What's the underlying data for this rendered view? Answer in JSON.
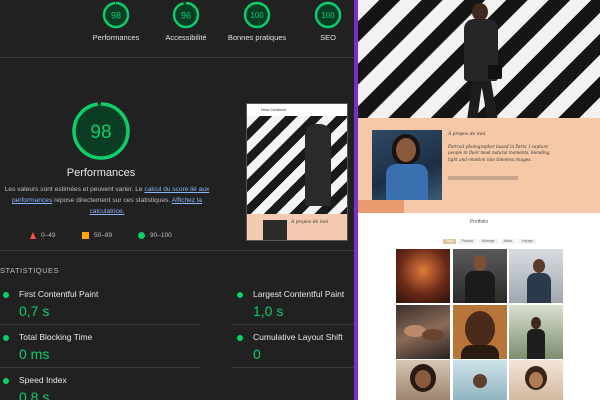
{
  "report": {
    "top_scores": [
      {
        "score": "98",
        "label": "Performances"
      },
      {
        "score": "96",
        "label": "Accessibilité"
      },
      {
        "score": "100",
        "label": "Bonnes pratiques"
      },
      {
        "score": "100",
        "label": "SEO"
      }
    ],
    "main_score": "98",
    "main_title": "Performances",
    "desc_part1": "Les valeurs sont estimées et peuvent varier. Le ",
    "desc_link1": "calcul du score lié aux performances",
    "desc_part2": " repose directement sur ces statistiques. ",
    "desc_link2": "Affichez la calculatrice.",
    "legend": [
      "0–49",
      "50–89",
      "90–100"
    ],
    "stats_title": "STATISTIQUES",
    "metrics": [
      {
        "name": "First Contentful Paint",
        "value": "0,7 s"
      },
      {
        "name": "Largest Contentful Paint",
        "value": "1,0 s"
      },
      {
        "name": "Total Blocking Time",
        "value": "0 ms"
      },
      {
        "name": "Cumulative Layout Shift",
        "value": "0"
      },
      {
        "name": "Speed Index",
        "value": "0,8 s"
      }
    ],
    "preview": {
      "header_text": "Nina Cerbucci",
      "about_text": "À propos de moi"
    },
    "colors": {
      "pass": "#0cce6b",
      "average": "#ffa400",
      "fail": "#ff4e42"
    }
  },
  "site": {
    "about_title": "À propos de moi",
    "about_text": "Portrait photographer based in Paris. I capture people in their most natural moments, blending light and emotion into timeless images.",
    "portfolio_title": "Portfolio",
    "filters": [
      "Tout",
      "Portrait",
      "Mariage",
      "Mode",
      "Voyage"
    ]
  }
}
